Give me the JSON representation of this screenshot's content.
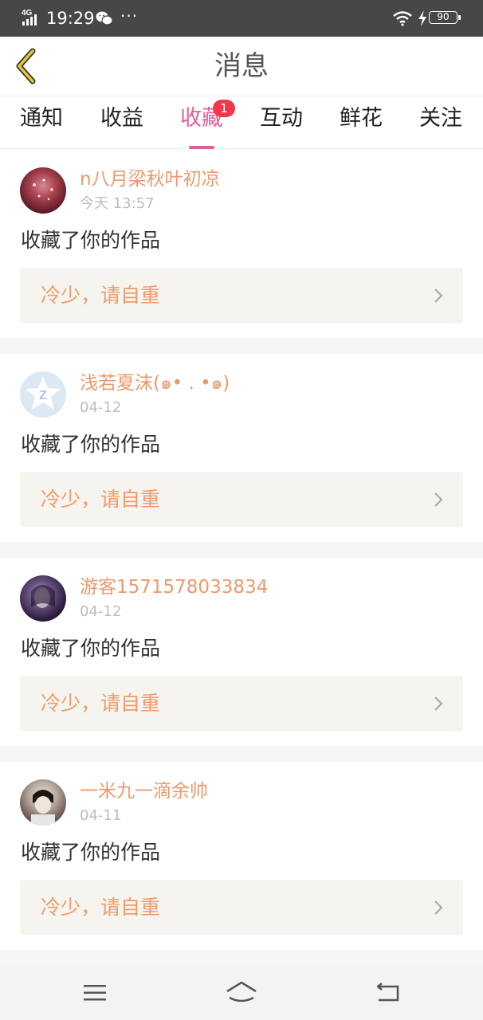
{
  "status_bar": {
    "network": "4G",
    "time": "19:29",
    "battery": "90"
  },
  "header": {
    "title": "消息"
  },
  "tabs": [
    {
      "label": "通知"
    },
    {
      "label": "收益"
    },
    {
      "label": "收藏",
      "active": true,
      "badge": "1"
    },
    {
      "label": "互动"
    },
    {
      "label": "鲜花"
    },
    {
      "label": "关注"
    }
  ],
  "items": [
    {
      "user": "n八月梁秋叶初凉",
      "time": "今天 13:57",
      "action": "收藏了你的作品",
      "work": "冷少，请自重"
    },
    {
      "user": "浅若夏沫(๑• . •๑)",
      "time": "04-12",
      "action": "收藏了你的作品",
      "work": "冷少，请自重"
    },
    {
      "user": "游客1571578033834",
      "time": "04-12",
      "action": "收藏了你的作品",
      "work": "冷少，请自重"
    },
    {
      "user": "一米九一滴余帅",
      "time": "04-11",
      "action": "收藏了你的作品",
      "work": "冷少，请自重"
    }
  ],
  "colors": {
    "accent": "#e0609c",
    "username": "#ec9a6c",
    "badge": "#f0384a",
    "work_box": "#f5f4ee"
  }
}
